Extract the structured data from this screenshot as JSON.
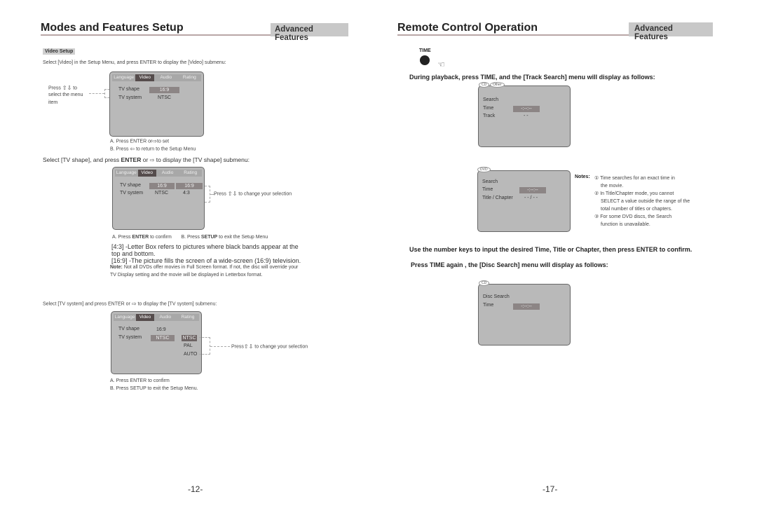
{
  "left_page": {
    "title": "Modes and Features Setup",
    "section_tab": "Advanced Features",
    "video_setup_label": "Video Setup",
    "intro": "Select [Video] in the Setup Menu, and press ENTER to display the [Video] submenu:",
    "menu_tabs": [
      "Language",
      "Video",
      "Audio",
      "Rating"
    ],
    "menu1": {
      "side_note_1": "Press",
      "side_note_2": "to",
      "side_note_3": "select the menu",
      "side_note_4": "item",
      "rows": [
        {
          "label": "TV shape",
          "value": "16:9"
        },
        {
          "label": "TV system",
          "value": "NTSC"
        }
      ],
      "step_a_1": "A.  Press  ENTER or",
      "step_a_2": "to set",
      "step_b_1": "B.  Press",
      "step_b_2": "to return to the Setup Menu"
    },
    "shape_intro_1": "Select [TV shape], and press",
    "shape_intro_enter": "ENTER",
    "shape_intro_2": "or",
    "shape_intro_3": "to display the [TV shape] submenu:",
    "menu2": {
      "rows": [
        {
          "label": "TV shape",
          "value": "16:9",
          "option": "16:9"
        },
        {
          "label": "TV system",
          "value": "NTSC",
          "option": "4:3"
        }
      ],
      "change_note_1": "Press",
      "change_note_2": "to change your selection",
      "step_a_1": "A.  Press",
      "step_a_bold": "ENTER",
      "step_a_2": "to confirm",
      "step_b_1": "B.  Press",
      "step_b_bold": "SETUP",
      "step_b_2": "to exit the Setup Menu"
    },
    "desc_43_line1": "[4:3] -Letter Box refers to pictures where black bands appear at the",
    "desc_43_line2": "top and bottom.",
    "desc_169": "[16:9] -The picture fills the screen of a wide-screen (16:9) television.",
    "note_label": "Note:",
    "note_line1": "Not all DVDs offer movies in Full Screen format. If not, the disc will override your",
    "note_line2": "TV Display setting and the movie will be displayed in Letterbox format.",
    "system_intro_1": "Select [TV system] and press ENTER or",
    "system_intro_2": "to display the [TV system] submenu:",
    "menu3": {
      "rows": [
        {
          "label": "TV shape",
          "value": "16:9"
        },
        {
          "label": "TV system",
          "value": "NTSC"
        }
      ],
      "options": [
        "NTSC",
        "PAL",
        "AUTO"
      ],
      "change_note_1": "Press",
      "change_note_2": "to change your selection",
      "step_a": "A.  Press  ENTER  to confirm",
      "step_b": "B.  Press SETUP to exit the Setup Menu."
    },
    "page_number": "-12-"
  },
  "right_page": {
    "title": "Remote Control Operation",
    "section_tab": "Advanced Features",
    "time_button_label": "TIME",
    "track_search_intro": "During playback, press  TIME, and the [Track Search] menu will display as follows:",
    "cd_menu": {
      "tags": [
        "CD",
        "Other"
      ],
      "heading": "Search",
      "rows": [
        {
          "label": "Time",
          "value": "-:--:--"
        },
        {
          "label": "Track",
          "value": "- -"
        }
      ]
    },
    "dvd_menu": {
      "tag": "DVD",
      "heading": "Search",
      "rows": [
        {
          "label": "Time",
          "value": "-:--:--"
        },
        {
          "label": "Title / Chapter",
          "value": "- - / - -"
        }
      ]
    },
    "notes_label": "Notes:",
    "notes": [
      {
        "marker": "①",
        "lines": [
          "Time searches for an exact time in",
          "the movie."
        ]
      },
      {
        "marker": "②",
        "lines": [
          "In Title/Chapter mode, you cannot",
          "SELECT a value outside the range of the",
          "total number of titles or chapters."
        ]
      },
      {
        "marker": "③",
        "lines": [
          "For some DVD discs, the Search",
          "function is unavailable."
        ]
      }
    ],
    "number_keys_instruction": "Use the number keys to input  the desired Time, Title or Chapter, then press ENTER to confirm.",
    "disc_search_intro": "Press  TIME again , the [Disc Search] menu will display as follows:",
    "disc_menu": {
      "tag": "CD",
      "heading": "Disc Search",
      "rows": [
        {
          "label": "Time",
          "value": "-:--:--"
        }
      ]
    },
    "page_number": "-17-"
  }
}
